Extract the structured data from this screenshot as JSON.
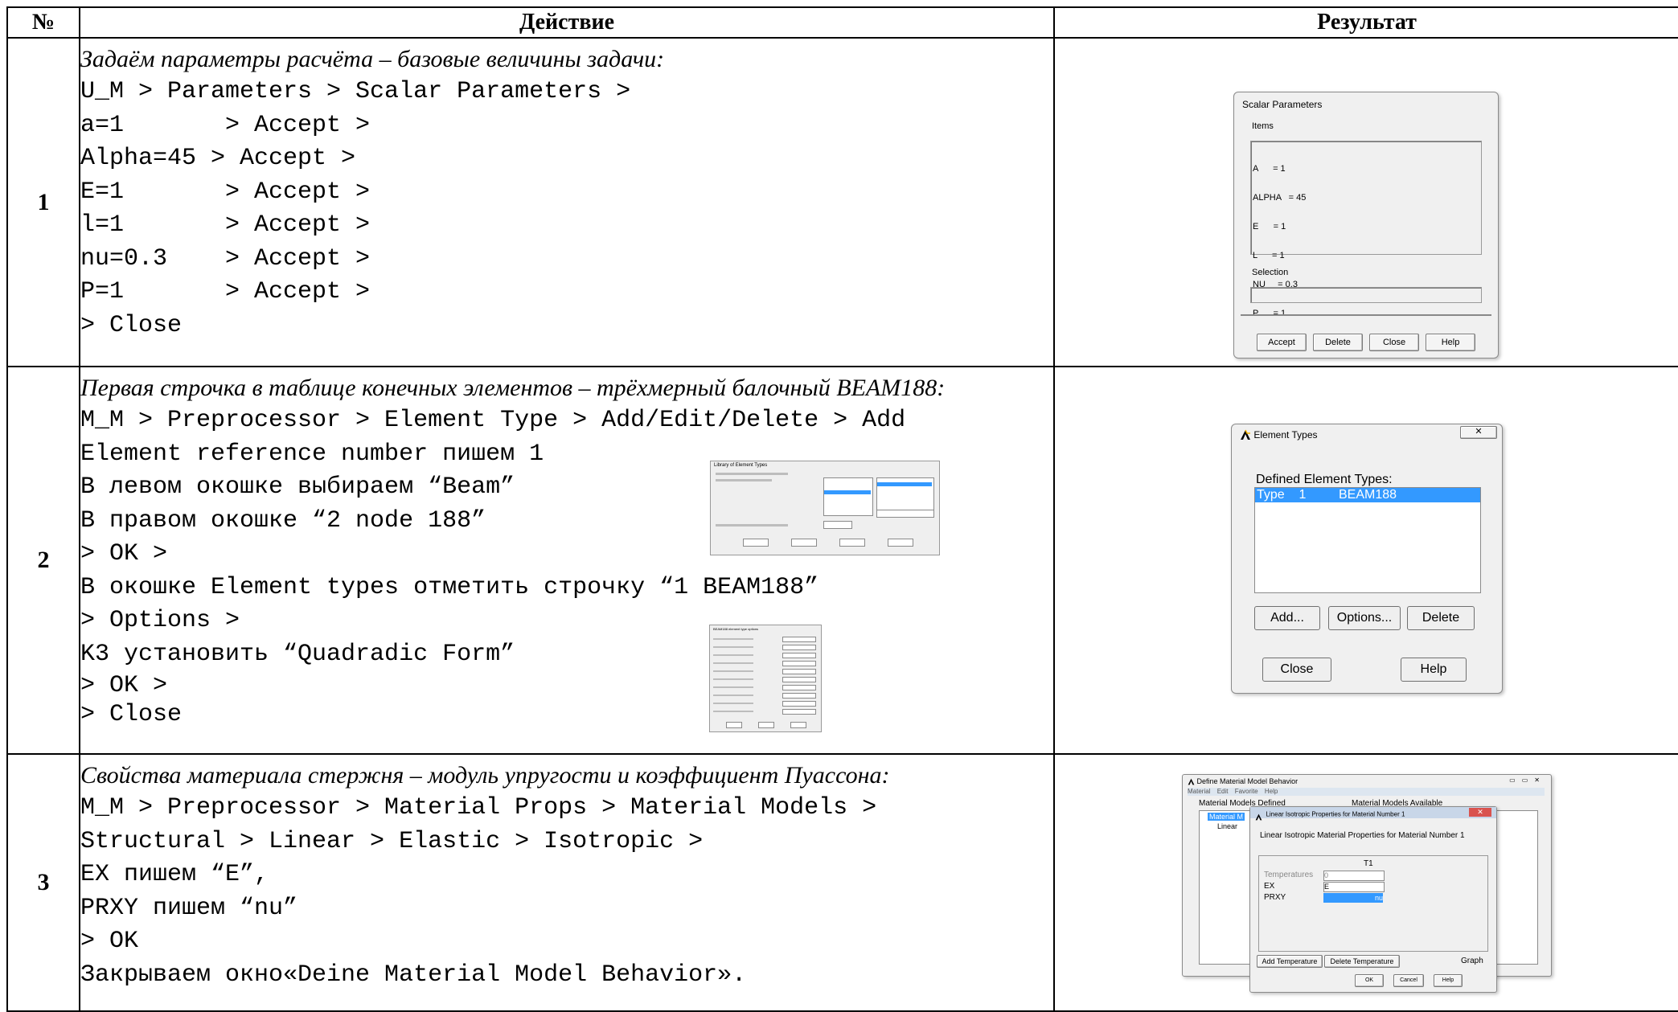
{
  "header": {
    "num": "№",
    "action": "Действие",
    "result": "Результат"
  },
  "rows": [
    {
      "num": "1",
      "heading": "Задаём параметры расчёта – базовые величины задачи:",
      "lines": [
        "U_M > Parameters > Scalar Parameters >",
        "a=1       > Accept >",
        "Alpha=45 > Accept >",
        "E=1       > Accept >",
        "l=1       > Accept >",
        "nu=0.3    > Accept >",
        "P=1       > Accept >",
        "> Close"
      ]
    },
    {
      "num": "2",
      "heading": "Первая строчка в таблице конечных элементов – трёхмерный балочный BEAM188:",
      "lines": [
        "M_M > Preprocessor > Element Type > Add/Edit/Delete > Add",
        "Element reference number пишем 1",
        "В левом окошке выбираем “Beam”",
        "В правом окошке “2 node 188”",
        "> OK >",
        "В окошке Element types отметить строчку “1 BEAM188”",
        "> Options >",
        "K3 установить “Quadradic Form”",
        "> OK >",
        "> Close"
      ]
    },
    {
      "num": "3",
      "heading": "Свойства материала стержня – модуль упругости и коэффициент Пуассона:",
      "lines": [
        "M_M > Preprocessor > Material Props > Material Models >",
        "Structural > Linear > Elastic > Isotropic >",
        "EX пишем “E”,",
        "PRXY пишем “nu”",
        "> OK",
        "Закрываем окно«Deine Material Model Behavior»."
      ]
    }
  ],
  "scalar_dialog": {
    "title": "Scalar Parameters",
    "items_label": "Items",
    "items": [
      "A      = 1",
      "ALPHA   = 45",
      "E      = 1",
      "L      = 1",
      "NU     = 0.3",
      "P      = 1"
    ],
    "selection_label": "Selection",
    "buttons": [
      "Accept",
      "Delete",
      "Close",
      "Help"
    ]
  },
  "element_dialog": {
    "title": "Element Types",
    "defined_label": "Defined Element Types:",
    "row_type": "Type    1",
    "row_name": "BEAM188",
    "buttons": [
      "Add...",
      "Options...",
      "Delete",
      "Close",
      "Help"
    ]
  },
  "material_dialog": {
    "title": "Define Material Model Behavior",
    "menu": [
      "Material",
      "Edit",
      "Favorite",
      "Help"
    ],
    "defined_label": "Material Models Defined",
    "available_label": "Material Models Available",
    "tree_item_1": "Material M",
    "tree_item_2": "Linear",
    "sub_title": "Linear Isotropic Properties for Material Number 1",
    "sub_heading": "Linear Isotropic Material Properties for Material Number 1",
    "col_t1": "T1",
    "temperatures_label": "Temperatures",
    "temperatures_value": "0",
    "ex_label": "EX",
    "ex_value": "E",
    "prxy_label": "PRXY",
    "prxy_value": "nu",
    "buttons": [
      "Add Temperature",
      "Delete Temperature",
      "Graph"
    ],
    "bottom_buttons": [
      "OK",
      "Cancel",
      "Help"
    ]
  },
  "thumb_library": {
    "title": "Library of Element Types"
  },
  "thumb_options": {
    "title": "BEAM188 element type options"
  }
}
